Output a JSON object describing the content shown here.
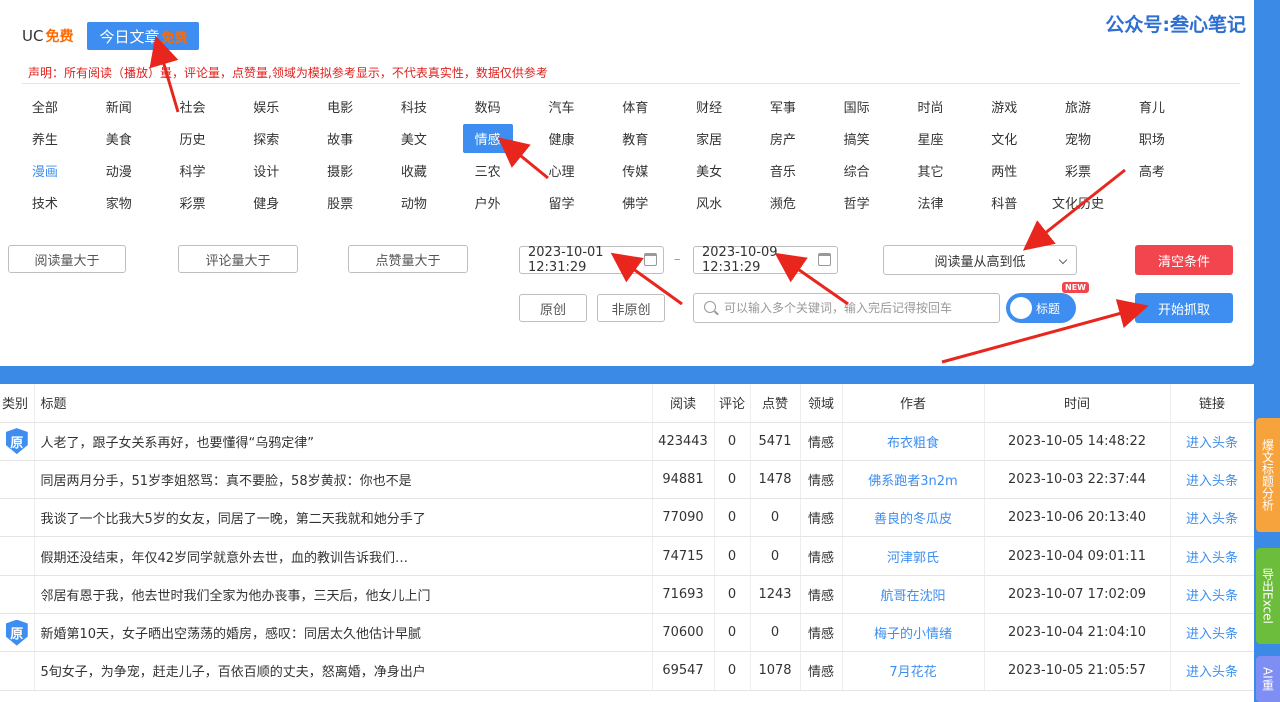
{
  "brand": {
    "uc": "UC",
    "uc_free": "免费",
    "today_tab": "今日文章",
    "today_free": "免费"
  },
  "watermark": "公众号:叁心笔记",
  "disclaimer": "声明：所有阅读（播放）量，评论量，点赞量,领域为模拟参考显示，不代表真实性，数据仅供参考",
  "categories": [
    "全部",
    "新闻",
    "社会",
    "娱乐",
    "电影",
    "科技",
    "数码",
    "汽车",
    "体育",
    "财经",
    "军事",
    "国际",
    "时尚",
    "游戏",
    "旅游",
    "育儿",
    "养生",
    "美食",
    "历史",
    "探索",
    "故事",
    "美文",
    "情感",
    "健康",
    "教育",
    "家居",
    "房产",
    "搞笑",
    "星座",
    "文化",
    "宠物",
    "职场",
    "漫画",
    "动漫",
    "科学",
    "设计",
    "摄影",
    "收藏",
    "三农",
    "心理",
    "传媒",
    "美女",
    "音乐",
    "综合",
    "其它",
    "两性",
    "彩票",
    "高考",
    "技术",
    "家物",
    "彩票",
    "健身",
    "股票",
    "动物",
    "户外",
    "留学",
    "佛学",
    "风水",
    "濒危",
    "哲学",
    "法律",
    "科普",
    "文化历史"
  ],
  "active_category": "情感",
  "highlight_category": "漫画",
  "filters": {
    "read_gt": "阅读量大于",
    "comment_gt": "评论量大于",
    "like_gt": "点赞量大于"
  },
  "date_range": {
    "start": "2023-10-01 12:31:29",
    "end": "2023-10-09 12:31:29"
  },
  "sort": {
    "selected": "阅读量从高到低"
  },
  "buttons": {
    "clear": "清空条件",
    "start": "开始抓取",
    "original": "原创",
    "non_original": "非原创"
  },
  "search": {
    "placeholder": "可以输入多个关键词，输入完后记得按回车"
  },
  "toggle": {
    "label": "标题",
    "badge": "NEW"
  },
  "table": {
    "headers": [
      "类别",
      "标题",
      "阅读",
      "评论",
      "点赞",
      "领域",
      "作者",
      "时间",
      "链接"
    ],
    "original_badge": "原",
    "rows": [
      {
        "original": true,
        "title": "人老了，跟子女关系再好，也要懂得“乌鸦定律”",
        "reads": "423443",
        "comments": "0",
        "likes": "5471",
        "domain": "情感",
        "author": "布衣粗食",
        "time": "2023-10-05 14:48:22",
        "link": "进入头条"
      },
      {
        "original": false,
        "title": "同居两月分手，51岁李姐怒骂：真不要脸，58岁黄叔：你也不是",
        "reads": "94881",
        "comments": "0",
        "likes": "1478",
        "domain": "情感",
        "author": "佛系跑者3n2m",
        "time": "2023-10-03 22:37:44",
        "link": "进入头条"
      },
      {
        "original": false,
        "title": "我谈了一个比我大5岁的女友，同居了一晚，第二天我就和她分手了",
        "reads": "77090",
        "comments": "0",
        "likes": "0",
        "domain": "情感",
        "author": "善良的冬瓜皮",
        "time": "2023-10-06 20:13:40",
        "link": "进入头条"
      },
      {
        "original": false,
        "title": "假期还没结束，年仅42岁同学就意外去世，血的教训告诉我们…",
        "reads": "74715",
        "comments": "0",
        "likes": "0",
        "domain": "情感",
        "author": "河津郭氏",
        "time": "2023-10-04 09:01:11",
        "link": "进入头条"
      },
      {
        "original": false,
        "title": "邻居有恩于我，他去世时我们全家为他办丧事，三天后，他女儿上门",
        "reads": "71693",
        "comments": "0",
        "likes": "1243",
        "domain": "情感",
        "author": "航哥在沈阳",
        "time": "2023-10-07 17:02:09",
        "link": "进入头条"
      },
      {
        "original": true,
        "title": "新婚第10天，女子晒出空荡荡的婚房，感叹：同居太久他估计早腻",
        "reads": "70600",
        "comments": "0",
        "likes": "0",
        "domain": "情感",
        "author": "梅子的小情绪",
        "time": "2023-10-04 21:04:10",
        "link": "进入头条"
      },
      {
        "original": false,
        "title": "5旬女子，为争宠，赶走儿子，百依百顺的丈夫，怒离婚，净身出户",
        "reads": "69547",
        "comments": "0",
        "likes": "1078",
        "domain": "情感",
        "author": "7月花花",
        "time": "2023-10-05 21:05:57",
        "link": "进入头条"
      }
    ]
  },
  "side_tabs": {
    "analysis": "爆文标题分析",
    "export": "导出Excel",
    "other": "AI重"
  }
}
